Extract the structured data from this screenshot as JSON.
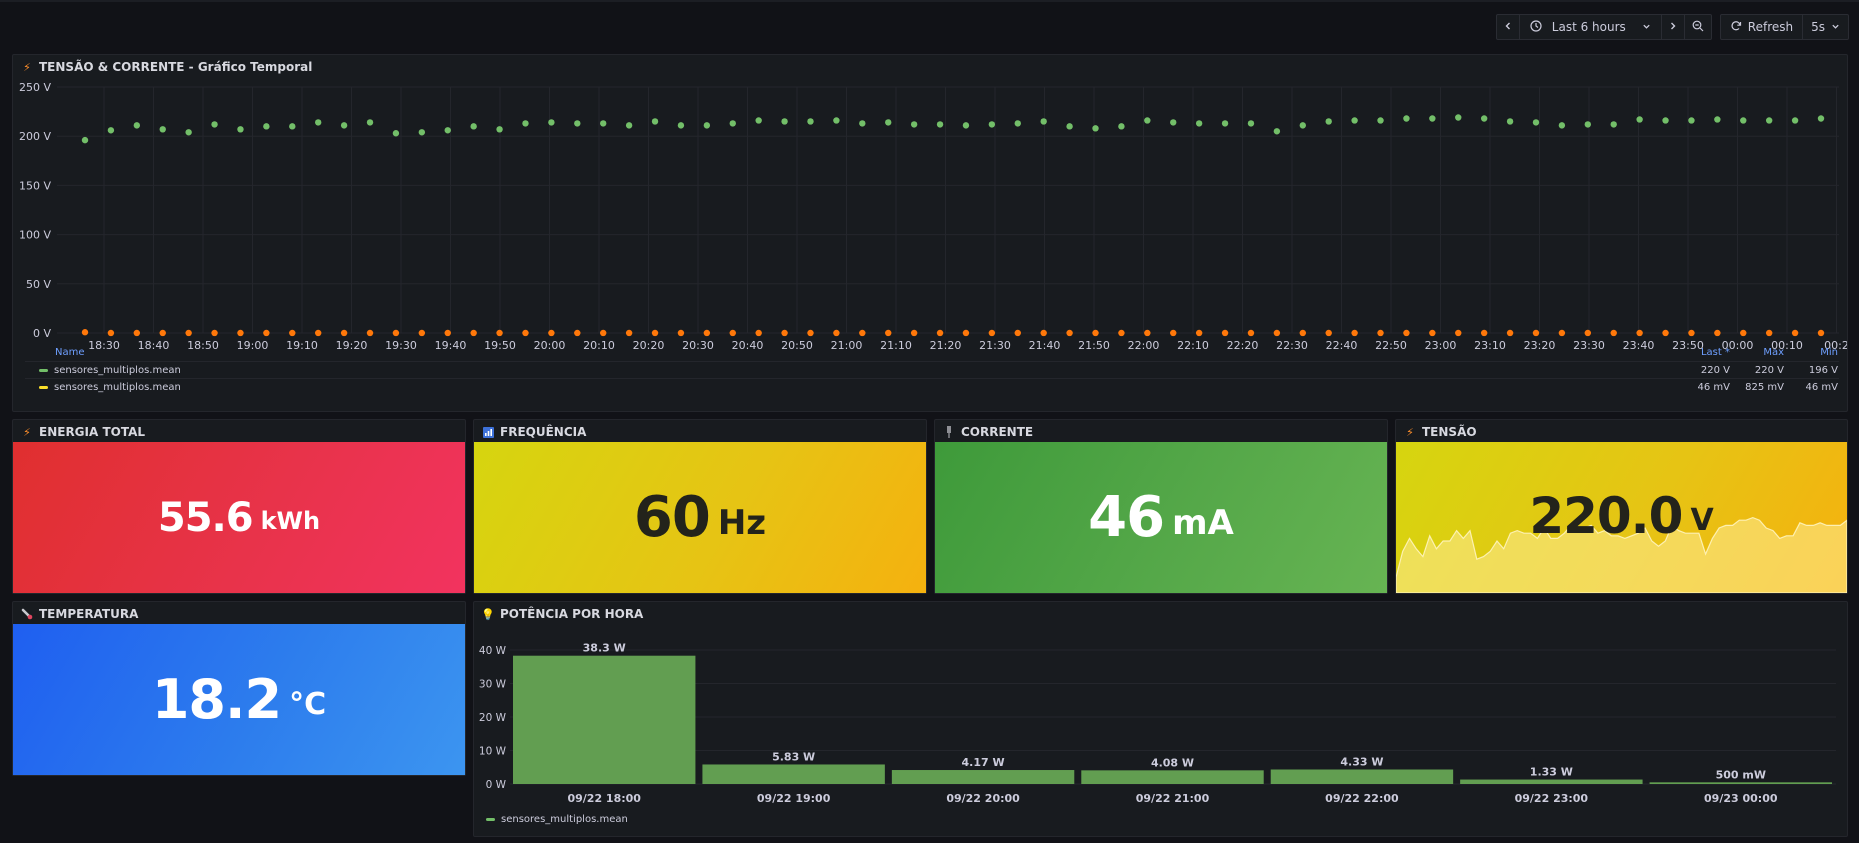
{
  "toolbar": {
    "prev_icon": "chevron-left-icon",
    "time_range": "Last 6 hours",
    "next_icon": "chevron-right-icon",
    "zoom_icon": "zoom-out-icon",
    "refresh_label": "Refresh",
    "refresh_interval": "5s"
  },
  "timeseries_panel": {
    "title": "TENSÃO & CORRENTE - Gráfico Temporal",
    "icon": "bolt-icon",
    "legend": {
      "headers": [
        "Name",
        "Last *",
        "Max",
        "Min"
      ],
      "rows": [
        {
          "name": "sensores_multiplos.mean",
          "color": "#73bf69",
          "last": "220 V",
          "max": "220 V",
          "min": "196 V"
        },
        {
          "name": "sensores_multiplos.mean",
          "color": "#fade2a",
          "last": "46 mV",
          "max": "825 mV",
          "min": "46 mV"
        }
      ]
    }
  },
  "stats": {
    "energia": {
      "title": "ENERGIA TOTAL",
      "icon": "bolt-icon",
      "value": "55.6",
      "unit": "kWh"
    },
    "frequencia": {
      "title": "FREQUÊNCIA",
      "icon": "bar-chart-icon",
      "value": "60",
      "unit": "Hz"
    },
    "corrente": {
      "title": "CORRENTE",
      "icon": "plug-icon",
      "value": "46",
      "unit": "mA"
    },
    "tensao": {
      "title": "TENSÃO",
      "icon": "bolt-icon",
      "value": "220.0",
      "unit": "V"
    },
    "temperatura": {
      "title": "TEMPERATURA",
      "icon": "thermometer-icon",
      "value": "18.2",
      "unit": "°C"
    }
  },
  "power_panel": {
    "title": "POTÊNCIA POR HORA",
    "icon": "lightbulb-icon",
    "legend_label": "sensores_multiplos.mean"
  },
  "chart_data": [
    {
      "type": "scatter",
      "title": "TENSÃO & CORRENTE - Gráfico Temporal",
      "y_ticks": [
        "250 V",
        "200 V",
        "150 V",
        "100 V",
        "50 V",
        "0 V"
      ],
      "ylim": [
        0,
        250
      ],
      "x_ticks": [
        "18:30",
        "18:40",
        "18:50",
        "19:00",
        "19:10",
        "19:20",
        "19:30",
        "19:40",
        "19:50",
        "20:00",
        "20:10",
        "20:20",
        "20:30",
        "20:40",
        "20:50",
        "21:00",
        "21:10",
        "21:20",
        "21:30",
        "21:40",
        "21:50",
        "22:00",
        "22:10",
        "22:20",
        "22:30",
        "22:40",
        "22:50",
        "23:00",
        "23:10",
        "23:20",
        "23:30",
        "23:40",
        "23:50",
        "00:00",
        "00:10",
        "00:2"
      ],
      "grid": true,
      "series": [
        {
          "name": "sensores_multiplos.mean",
          "color": "#73bf69",
          "values": [
            196,
            206,
            211,
            207,
            204,
            212,
            207,
            210,
            210,
            214,
            211,
            214,
            203,
            204,
            206,
            210,
            207,
            213,
            214,
            213,
            213,
            211,
            215,
            211,
            211,
            213,
            216,
            215,
            215,
            216,
            213,
            214,
            212,
            212,
            211,
            212,
            213,
            215,
            210,
            208,
            210,
            216,
            214,
            213,
            213,
            213,
            205,
            211,
            215,
            216,
            216,
            218,
            218,
            219,
            218,
            215,
            214,
            211,
            212,
            212,
            217,
            216,
            216,
            217,
            216,
            216,
            216,
            218
          ]
        },
        {
          "name": "sensores_multiplos.mean",
          "color": "#ff780a",
          "values": [
            0.8,
            0.05,
            0.05,
            0.05,
            0.05,
            0.05,
            0.05,
            0.05,
            0.05,
            0.05,
            0.05,
            0.05,
            0.05,
            0.05,
            0.05,
            0.05,
            0.05,
            0.05,
            0.05,
            0.05,
            0.05,
            0.05,
            0.05,
            0.05,
            0.05,
            0.05,
            0.05,
            0.05,
            0.05,
            0.05,
            0.05,
            0.05,
            0.05,
            0.05,
            0.05,
            0.05,
            0.05,
            0.05,
            0.05,
            0.05,
            0.05,
            0.05,
            0.05,
            0.05,
            0.05,
            0.05,
            0.05,
            0.05,
            0.05,
            0.05,
            0.05,
            0.05,
            0.05,
            0.05,
            0.05,
            0.05,
            0.05,
            0.05,
            0.05,
            0.05,
            0.05,
            0.05,
            0.05,
            0.05,
            0.05,
            0.05,
            0.05,
            0.05
          ]
        }
      ]
    },
    {
      "type": "bar",
      "title": "POTÊNCIA POR HORA",
      "categories": [
        "09/22 18:00",
        "09/22 19:00",
        "09/22 20:00",
        "09/22 21:00",
        "09/22 22:00",
        "09/22 23:00",
        "09/23 00:00"
      ],
      "values": [
        38.3,
        5.83,
        4.17,
        4.08,
        4.33,
        1.33,
        0.5
      ],
      "data_labels": [
        "38.3 W",
        "5.83 W",
        "4.17 W",
        "4.08 W",
        "4.33 W",
        "1.33 W",
        "500 mW"
      ],
      "y_ticks": [
        "40 W",
        "30 W",
        "20 W",
        "10 W",
        "0 W"
      ],
      "ylim": [
        0,
        40
      ],
      "series": [
        {
          "name": "sensores_multiplos.mean",
          "color": "#629e51"
        }
      ]
    },
    {
      "type": "area",
      "title": "TENSÃO",
      "values": [
        196,
        206,
        211,
        207,
        204,
        212,
        207,
        210,
        210,
        214,
        211,
        214,
        203,
        204,
        206,
        210,
        207,
        213,
        214,
        213,
        213,
        211,
        215,
        211,
        211,
        213,
        216,
        215,
        215,
        216,
        213,
        214,
        212,
        212,
        211,
        212,
        213,
        215,
        210,
        208,
        210,
        216,
        214,
        213,
        213,
        213,
        205,
        211,
        215,
        216,
        216,
        218,
        218,
        219,
        218,
        215,
        214,
        211,
        212,
        212,
        217,
        216,
        216,
        217,
        216,
        216,
        216,
        218
      ],
      "ylim": [
        190,
        225
      ]
    }
  ]
}
